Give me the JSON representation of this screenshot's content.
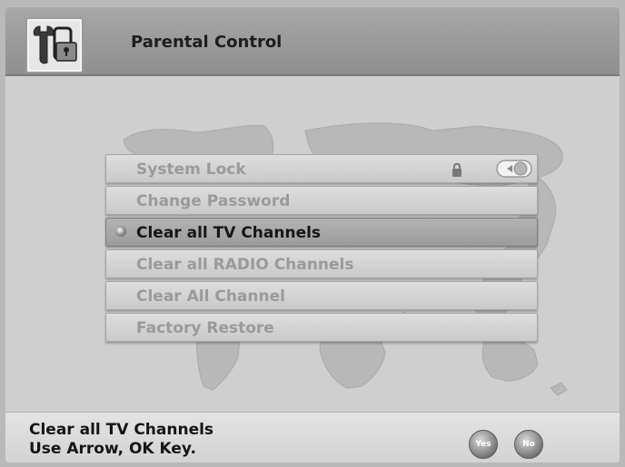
{
  "header": {
    "title": "Parental Control",
    "icon": "settings-lock-icon"
  },
  "menu": {
    "items": [
      {
        "label": "System Lock",
        "state": "disabled"
      },
      {
        "label": "Change Password",
        "state": "disabled"
      },
      {
        "label": "Clear all TV Channels",
        "state": "selected"
      },
      {
        "label": "Clear all RADIO Channels",
        "state": "disabled"
      },
      {
        "label": "Clear All Channel",
        "state": "disabled"
      },
      {
        "label": "Factory Restore",
        "state": "disabled"
      }
    ]
  },
  "footer": {
    "line1": "Clear all TV Channels",
    "line2": "Use Arrow, OK Key.",
    "yes_label": "Yes",
    "no_label": "No"
  },
  "colors": {
    "background": "#cfcfcf",
    "header": "#9a9a9a",
    "selected_item": "#a8a8a8",
    "text_dark": "#161616",
    "text_disabled": "#9a9a9a"
  }
}
